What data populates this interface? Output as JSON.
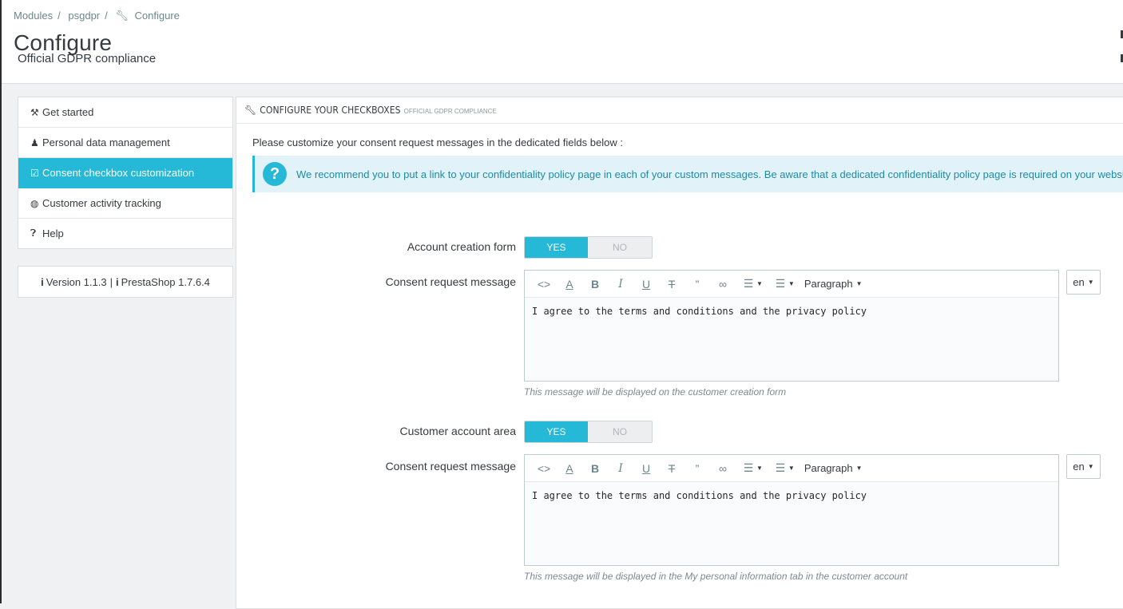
{
  "breadcrumb": [
    "Modules",
    "psgdpr",
    "Configure"
  ],
  "page": {
    "title": "Configure",
    "subtitle": "Official GDPR compliance"
  },
  "menu": {
    "items": [
      {
        "label": "Get started",
        "icon": "gavel-icon"
      },
      {
        "label": "Personal data management",
        "icon": "user-secret-icon"
      },
      {
        "label": "Consent checkbox customization",
        "icon": "check-square-icon"
      },
      {
        "label": "Customer activity tracking",
        "icon": "user-circle-icon"
      },
      {
        "label": "Help",
        "icon": "question-circle-icon"
      }
    ],
    "active_index": 2
  },
  "version": {
    "module": "Version 1.1.3",
    "separator": "|",
    "prestashop": "PrestaShop 1.7.6.4"
  },
  "panel": {
    "title": "CONFIGURE YOUR CHECKBOXES",
    "subtitle": "OFFICIAL GDPR COMPLIANCE",
    "intro": "Please customize your consent request messages in the dedicated fields below :",
    "alert": "We recommend you to put a link to your confidentiality policy page in each of your custom messages. Be aware that a dedicated confidentiality policy page is required on your website; if y"
  },
  "form": {
    "sections": [
      {
        "switch_label": "Account creation form",
        "yes": "YES",
        "no": "NO",
        "value": "YES",
        "message_label": "Consent request message",
        "message": "I agree to the terms and conditions and the privacy policy",
        "help": "This message will be displayed on the customer creation form",
        "lang": "en"
      },
      {
        "switch_label": "Customer account area",
        "yes": "YES",
        "no": "NO",
        "value": "YES",
        "message_label": "Consent request message",
        "message": "I agree to the terms and conditions and the privacy policy",
        "help": "This message will be displayed in the My personal information tab in the customer account",
        "lang": "en"
      }
    ],
    "toolbar": {
      "paragraph": "Paragraph"
    }
  },
  "colors": {
    "accent": "#25b9d7",
    "alert_bg": "#e1f3f8"
  }
}
